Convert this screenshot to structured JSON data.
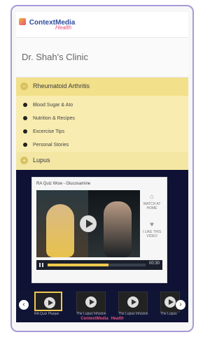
{
  "brand": {
    "name": "ContextMedia",
    "subtitle": "Health",
    "footer_name": "ContextMedia",
    "footer_sub": "Health"
  },
  "clinic": {
    "title": "Dr. Shah's Clinic"
  },
  "accordion": [
    {
      "title": "Rheumatoid Arthritis",
      "expanded": true,
      "items": [
        {
          "label": "Blood Sugar & Ato"
        },
        {
          "label": "Nutrition & Recipes"
        },
        {
          "label": "Excercise Tips"
        },
        {
          "label": "Personal Stories"
        }
      ]
    },
    {
      "title": "Lupus",
      "expanded": false,
      "items": []
    }
  ],
  "video": {
    "title": "RA Quiz Wow - Glucosamine",
    "actions": [
      {
        "label": "WATCH AT HOME"
      },
      {
        "label": "I LIKE THIS VIDEO"
      }
    ],
    "time": "00:30",
    "progress": 0.62
  },
  "thumbnails": [
    {
      "label": "RA Quiz Plaque"
    },
    {
      "label": "The Lupus Infusion"
    },
    {
      "label": "The Lupus Infusion"
    },
    {
      "label": "The Lupus"
    }
  ],
  "icons": {
    "expand": "minus-circle-icon",
    "collapse": "plus-circle-icon",
    "play": "play-icon",
    "pause": "pause-icon",
    "prev": "chevron-left-icon",
    "next": "chevron-right-icon",
    "watch_at_home": "house-icon",
    "like": "heart-icon"
  },
  "colors": {
    "frame": "#a89ad6",
    "brand_blue": "#2e4d9b",
    "brand_pink": "#e84f7c",
    "accordion_yellow": "#f2e08a",
    "player_bg": "#0f1234",
    "progress": "#f0c94e"
  }
}
